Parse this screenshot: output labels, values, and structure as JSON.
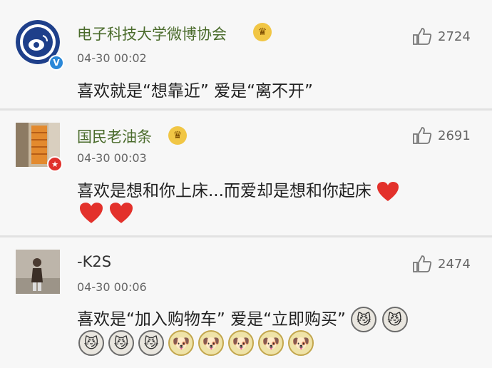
{
  "comments": [
    {
      "author": "电子科技大学微博协会",
      "time": "04-30 00:02",
      "likes": "2724",
      "text": "喜欢就是“想靠近” 爱是“离不开”",
      "badge": "V"
    },
    {
      "author": "国民老油条",
      "time": "04-30 00:03",
      "likes": "2691",
      "text": "喜欢是想和你上床...而爱却是想和你起床"
    },
    {
      "author": "-K2S",
      "time": "04-30 00:06",
      "likes": "2474",
      "text": "喜欢是“加入购物车”   爱是“立即购买”"
    }
  ],
  "icons": {
    "like": "thumbs-up-icon",
    "crown": "crown-icon",
    "heart": "heart-icon",
    "cat": "cat-face-icon",
    "doge": "doge-face-icon"
  },
  "colors": {
    "accent_green": "#4a6b2b",
    "heart_red": "#e3312b",
    "verified_blue": "#2b88d8",
    "crown_gold": "#f1c645"
  }
}
